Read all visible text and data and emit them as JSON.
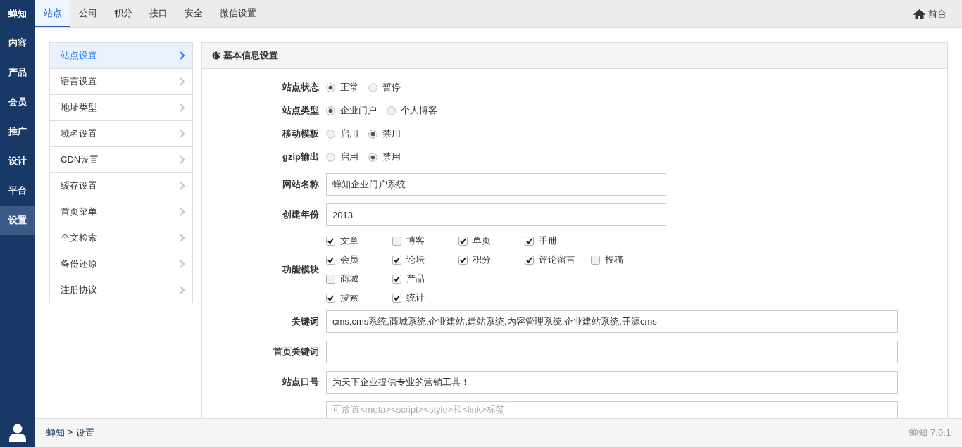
{
  "sidebar": {
    "logo": "蝉知",
    "items": [
      {
        "label": "内容",
        "selected": false
      },
      {
        "label": "产品",
        "selected": false
      },
      {
        "label": "会员",
        "selected": false
      },
      {
        "label": "推广",
        "selected": false
      },
      {
        "label": "设计",
        "selected": false
      },
      {
        "label": "平台",
        "selected": false
      },
      {
        "label": "设置",
        "selected": true
      }
    ]
  },
  "tabs": [
    {
      "label": "站点",
      "selected": true
    },
    {
      "label": "公司",
      "selected": false
    },
    {
      "label": "积分",
      "selected": false
    },
    {
      "label": "接口",
      "selected": false
    },
    {
      "label": "安全",
      "selected": false
    },
    {
      "label": "微信设置",
      "selected": false
    }
  ],
  "frontend_link": "前台",
  "submenu": [
    {
      "label": "站点设置",
      "selected": true
    },
    {
      "label": "语言设置",
      "selected": false
    },
    {
      "label": "地址类型",
      "selected": false
    },
    {
      "label": "域名设置",
      "selected": false
    },
    {
      "label": "CDN设置",
      "selected": false
    },
    {
      "label": "缓存设置",
      "selected": false
    },
    {
      "label": "首页菜单",
      "selected": false
    },
    {
      "label": "全文检索",
      "selected": false
    },
    {
      "label": "备份还原",
      "selected": false
    },
    {
      "label": "注册协议",
      "selected": false
    }
  ],
  "panel": {
    "title": "基本信息设置",
    "fields": [
      {
        "kind": "radio",
        "label": "站点状态",
        "options": [
          {
            "label": "正常",
            "selected": true
          },
          {
            "label": "暂停",
            "selected": false
          }
        ]
      },
      {
        "kind": "radio",
        "label": "站点类型",
        "options": [
          {
            "label": "企业门户",
            "selected": true
          },
          {
            "label": "个人博客",
            "selected": false
          }
        ]
      },
      {
        "kind": "radio",
        "label": "移动模板",
        "options": [
          {
            "label": "启用",
            "selected": false
          },
          {
            "label": "禁用",
            "selected": true
          }
        ]
      },
      {
        "kind": "radio",
        "label": "gzip输出",
        "options": [
          {
            "label": "启用",
            "selected": false
          },
          {
            "label": "禁用",
            "selected": true
          }
        ]
      },
      {
        "kind": "text",
        "label": "网站名称",
        "value": "蝉知企业门户系统",
        "wide": false
      },
      {
        "kind": "text",
        "label": "创建年份",
        "value": "2013",
        "wide": false
      },
      {
        "kind": "checkboxes",
        "label": "功能模块",
        "rows": [
          [
            {
              "label": "文章",
              "checked": true
            },
            {
              "label": "博客",
              "checked": false
            },
            {
              "label": "单页",
              "checked": true
            },
            {
              "label": "手册",
              "checked": true
            }
          ],
          [
            {
              "label": "会员",
              "checked": true
            },
            {
              "label": "论坛",
              "checked": true
            },
            {
              "label": "积分",
              "checked": true
            },
            {
              "label": "评论留言",
              "checked": true
            },
            {
              "label": "投稿",
              "checked": false
            }
          ],
          [
            {
              "label": "商城",
              "checked": false
            },
            {
              "label": "产品",
              "checked": true
            }
          ],
          [
            {
              "label": "搜索",
              "checked": true
            },
            {
              "label": "统计",
              "checked": true
            }
          ]
        ]
      },
      {
        "kind": "text",
        "label": "关键词",
        "value": "cms,cms系统,商城系统,企业建站,建站系统,内容管理系统,企业建站系统,开源cms",
        "wide": true
      },
      {
        "kind": "text",
        "label": "首页关键词",
        "wide": true
      },
      {
        "kind": "text",
        "label": "站点口号",
        "value": "为天下企业提供专业的营销工具！",
        "wide": true
      },
      {
        "kind": "textarea",
        "placeholder": "可放置<meta><script><style>和<link>标签"
      }
    ]
  },
  "footer": {
    "breadcrumb": [
      "蝉知",
      "设置"
    ],
    "separator": ">",
    "version": "蝉知 7.0.1"
  }
}
